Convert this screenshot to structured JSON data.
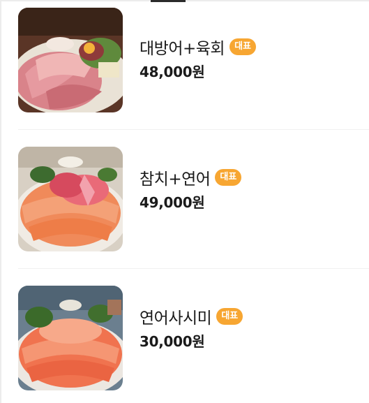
{
  "menu": {
    "items": [
      {
        "name": "대방어+육회",
        "badge": "대표",
        "price": "48,000원",
        "image": "yellowtail-yukhoe-platter"
      },
      {
        "name": "참치+연어",
        "badge": "대표",
        "price": "49,000원",
        "image": "tuna-salmon-platter"
      },
      {
        "name": "연어사시미",
        "badge": "대표",
        "price": "30,000원",
        "image": "salmon-sashimi-platter"
      }
    ]
  },
  "colors": {
    "badge": "#f7a632",
    "text": "#1a1a1a"
  }
}
